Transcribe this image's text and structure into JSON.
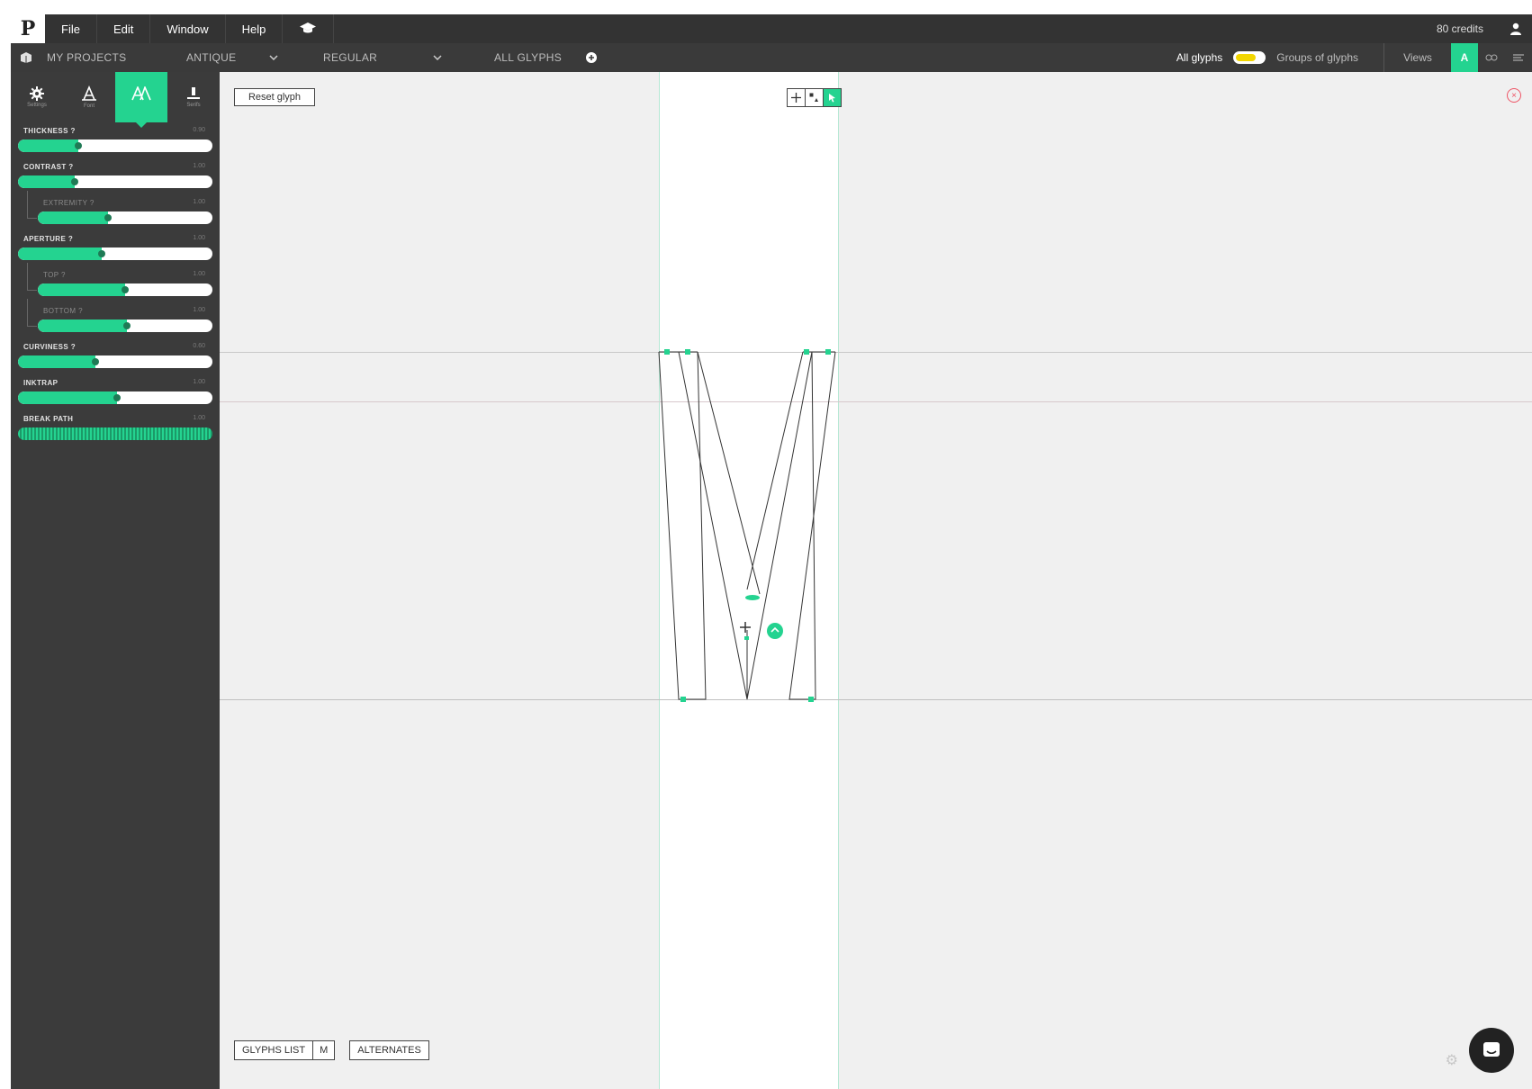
{
  "menubar": {
    "logo": "P",
    "items": [
      "File",
      "Edit",
      "Window",
      "Help"
    ],
    "credits": "80 credits"
  },
  "projectbar": {
    "my_projects": "MY PROJECTS",
    "family": "ANTIQUE",
    "variant": "REGULAR",
    "glyphs": "ALL GLYPHS",
    "all_glyphs": "All glyphs",
    "groups": "Groups of glyphs",
    "views": "Views",
    "view_a": "A"
  },
  "sidebar": {
    "tabs": [
      {
        "name": "settings",
        "caption": "Settings"
      },
      {
        "name": "font",
        "caption": "Font"
      },
      {
        "name": "glyph",
        "caption": ""
      },
      {
        "name": "serifs",
        "caption": "Serifs"
      }
    ],
    "params": [
      {
        "label": "THICKNESS ?",
        "value": "0.90",
        "fill": 0.31,
        "sub": false
      },
      {
        "label": "CONTRAST ?",
        "value": "1.00",
        "fill": 0.29,
        "sub": false
      },
      {
        "label": "EXTREMITY ?",
        "value": "1.00",
        "fill": 0.4,
        "sub": true
      },
      {
        "label": "APERTURE ?",
        "value": "1.00",
        "fill": 0.43,
        "sub": false
      },
      {
        "label": "TOP ?",
        "value": "1.00",
        "fill": 0.5,
        "sub": true
      },
      {
        "label": "BOTTOM ?",
        "value": "1.00",
        "fill": 0.51,
        "sub": true
      },
      {
        "label": "CURVINESS ?",
        "value": "0.60",
        "fill": 0.4,
        "sub": false
      },
      {
        "label": "INKTRAP",
        "value": "1.00",
        "fill": 0.51,
        "sub": false
      },
      {
        "label": "BREAK PATH",
        "value": "1.00",
        "fill": 1.0,
        "sub": false,
        "disabled": true
      }
    ]
  },
  "canvas": {
    "reset_label": "Reset glyph",
    "glyphs_list_label": "GLYPHS LIST",
    "glyphs_list_key": "M",
    "alternates_label": "ALTERNATES"
  },
  "colors": {
    "accent": "#24d390",
    "menubar": "#333333",
    "sidebar": "#3b3b3b",
    "toggle_knob": "#f2d600"
  }
}
